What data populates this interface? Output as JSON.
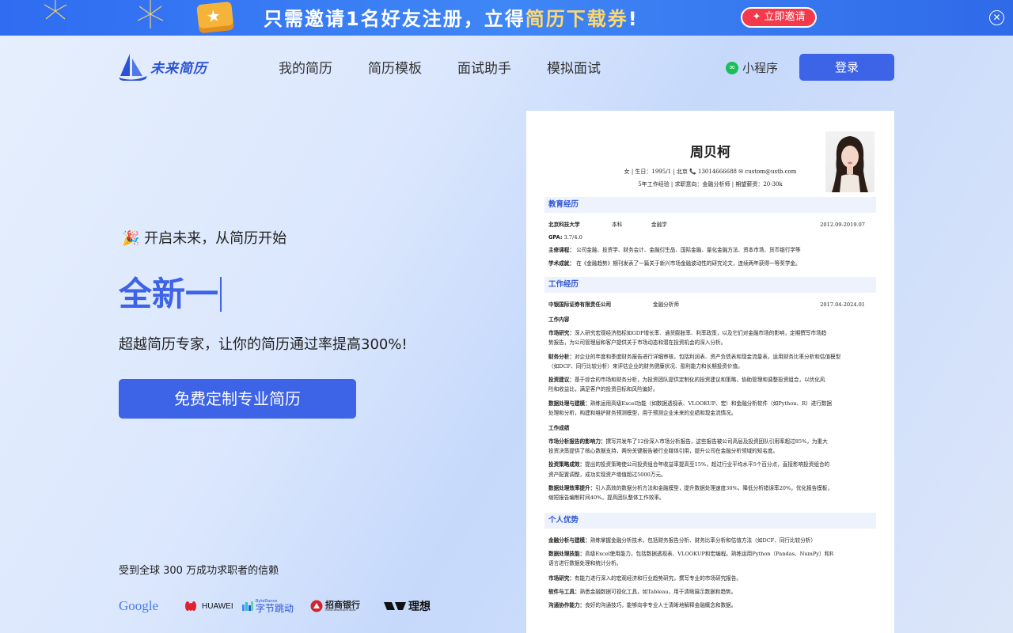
{
  "promo": {
    "text_prefix": "只需邀请1名好友注册，立得",
    "text_highlight": "简历下载券",
    "text_suffix": "!",
    "cta_label": "立即邀请",
    "close_glyph": "✕"
  },
  "brand": {
    "name": "未来简历",
    "accent": "#3d63e6"
  },
  "nav": {
    "items": [
      "我的简历",
      "简历模板",
      "面试助手",
      "模拟面试"
    ],
    "mini_program": "小程序",
    "login": "登录"
  },
  "hero": {
    "tag_emoji": "🎉",
    "tag": "开启未来，从简历开始",
    "title": "全新一",
    "subtitle": "超越简历专家，让你的简历通过率提高300%!",
    "cta": "免费定制专业简历",
    "trust": "受到全球 300 万成功求职者的信赖"
  },
  "logos": {
    "google": "Google",
    "huawei": "HUAWEI",
    "bytedance_small": "ByteDance",
    "bytedance": "字节跳动",
    "cmb": "招商银行",
    "cmb_en": "CHINA MERCHANTS BANK",
    "lenovo": "理想"
  },
  "resume": {
    "name": "周贝柯",
    "meta1": "女  |  生日：1995/1  |  北京  📞 13014666688   ✉  custom@ustb.com",
    "meta2": "5年工作经验  |  求职意向：金融分析师  |  期望薪资：20-30k",
    "edu_title": "教育经历",
    "edu": {
      "school": "北京科技大学",
      "degree": "本科",
      "major": "金融学",
      "date": "2012.09-2019.07",
      "gpa_label": "GPA:",
      "gpa": "3.7/4.0",
      "courses_label": "主修课程：",
      "courses": "公司金融、投资学、财务会计、金融衍生品、国际金融、量化金融方法、资本市场、货币银行学等",
      "honor_label": "学术成就：",
      "honor": "在《金融趋势》期刊发表了一篇关于新兴市场金融波动性的研究论文，连续两年获得一等奖学金。"
    },
    "work_title": "工作经历",
    "work": {
      "company": "中银国际证券有限责任公司",
      "role": "金融分析师",
      "date": "2017.04-2024.01",
      "content_label": "工作内容",
      "items": [
        {
          "k": "市场研究：",
          "v": "深入研究宏观经济指标如GDP增长率、通货膨胀率、利率政策，以及它们对金融市场的影响，定期撰写市场趋"
        },
        {
          "k": "",
          "v": "势报告，为公司管理层和客户提供关于市场动态和潜在投资机会的深入分析。"
        },
        {
          "k": "财务分析：",
          "v": "对企业的年度和季度财务报告进行详细审核，包括利润表、资产负债表和现金流量表，运用财务比率分析和估值模型"
        },
        {
          "k": "",
          "v": "（如DCF、同行比较分析）来评估企业的财务健康状况、盈利能力和长期投资价值。"
        },
        {
          "k": "投资建议：",
          "v": "基于综合的市场和财务分析，为投资团队提供定制化的投资建议和策略，协助管理和调整投资组合，以优化风"
        },
        {
          "k": "",
          "v": "险和收益比，满足客户的投资目标和风险偏好。"
        },
        {
          "k": "数据处理与建模：",
          "v": "熟练运用高级Excel功能（如数据透视表、VLOOKUP、宏）和金融分析软件（如Python、R）进行数据"
        },
        {
          "k": "",
          "v": "处理和分析，构建和维护财务预测模型，用于预测企业未来的业绩和现金流情况。"
        }
      ],
      "result_label": "工作成绩",
      "results": [
        {
          "k": "市场分析报告的影响力：",
          "v": "撰写并发布了12份深入市场分析报告，这些报告被公司高层及投资团队引用率超过85%，为重大"
        },
        {
          "k": "",
          "v": "投资决策提供了核心数据支持，两份关键报告被行业媒体引用，提升公司在金融分析领域的知名度。"
        },
        {
          "k": "投资策略成效：",
          "v": "提出的投资策略使公司投资组合年收益率提高至15%，超过行业平均水平5个百分点，直接影响投资组合的"
        },
        {
          "k": "",
          "v": "资产配置调整，成功实现资产增值超过5000万元。"
        },
        {
          "k": "数据处理效率提升：",
          "v": "引入高效的数据分析方法和金融模型，提升数据处理速度30%，降低分析错误率20%，优化报告模板，"
        },
        {
          "k": "",
          "v": "缩短报告编制时间40%，提高团队整体工作效率。"
        }
      ]
    },
    "adv_title": "个人优势",
    "advantages": [
      {
        "k": "金融分析与建模：",
        "v": "熟练掌握金融分析技术，包括财务报告分析、财务比率分析和估值方法（如DCF、同行比较分析）"
      },
      {
        "k": "数据处理技能：",
        "v": "高级Excel使用能力，包括数据透视表、VLOOKUP和宏编程。熟练运用Python（Pandas、NumPy）和R"
      },
      {
        "k": "",
        "v": "语言进行数据处理和统计分析。"
      },
      {
        "k": "市场研究：",
        "v": "有能力进行深入的宏观经济和行业趋势研究，撰写专业的市场研究报告。"
      },
      {
        "k": "软件与工具：",
        "v": "熟悉金融数据可视化工具，如Tableau，用于清晰展示数据和趋势。"
      },
      {
        "k": "沟通协作能力：",
        "v": "良好的沟通技巧，能够向非专业人士清晰地解释金融概念和数据。"
      }
    ]
  }
}
